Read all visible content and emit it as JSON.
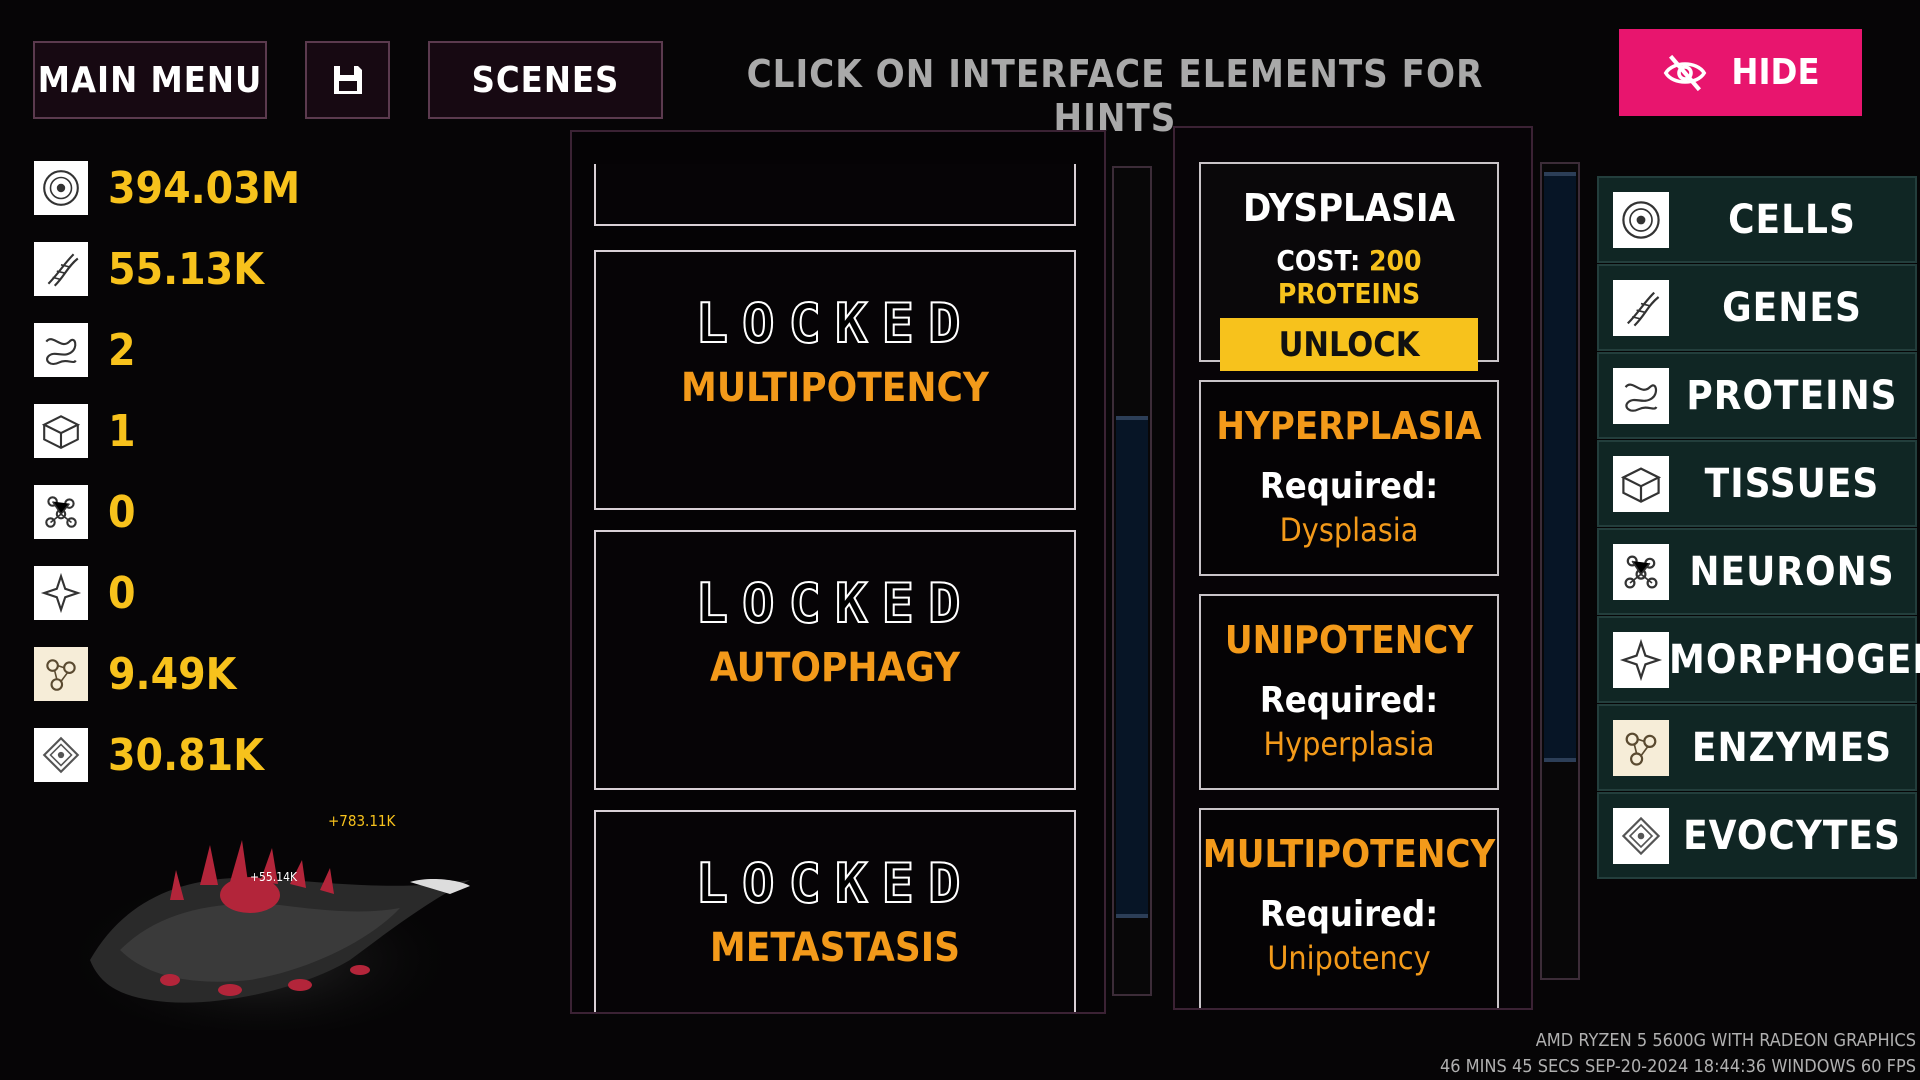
{
  "top_bar": {
    "main_menu": "MAIN MENU",
    "scenes": "SCENES",
    "hint": "CLICK ON INTERFACE ELEMENTS FOR HINTS",
    "hide": "HIDE"
  },
  "resources": [
    {
      "icon": "cell-icon",
      "value": "394.03M"
    },
    {
      "icon": "dna-icon",
      "value": "55.13K"
    },
    {
      "icon": "protein-icon",
      "value": "2"
    },
    {
      "icon": "tissue-icon",
      "value": "1"
    },
    {
      "icon": "neuron-icon",
      "value": "0"
    },
    {
      "icon": "morphogen-icon",
      "value": "0"
    },
    {
      "icon": "enzyme-icon",
      "value": "9.49K"
    },
    {
      "icon": "evocyte-icon",
      "value": "30.81K"
    }
  ],
  "creature": {
    "float_a": "+783.11K",
    "float_b": "+55.14K"
  },
  "locked_panel": {
    "locked_word": "LOCKED",
    "items": [
      "MULTIPOTENCY",
      "AUTOPHAGY",
      "METASTASIS"
    ]
  },
  "upgrades": {
    "first": {
      "title": "DYSPLASIA",
      "cost_label": "COST:",
      "cost_value": "200 PROTEINS",
      "unlock": "UNLOCK"
    },
    "required_label": "Required:",
    "items": [
      {
        "title": "HYPERPLASIA",
        "requires": "Dysplasia"
      },
      {
        "title": "UNIPOTENCY",
        "requires": "Hyperplasia"
      },
      {
        "title": "MULTIPOTENCY",
        "requires": "Unipotency"
      }
    ]
  },
  "categories": [
    {
      "label": "CELLS",
      "icon": "cell-icon"
    },
    {
      "label": "GENES",
      "icon": "dna-icon"
    },
    {
      "label": "PROTEINS",
      "icon": "protein-icon"
    },
    {
      "label": "TISSUES",
      "icon": "tissue-icon"
    },
    {
      "label": "NEURONS",
      "icon": "neuron-icon"
    },
    {
      "label": "MORPHOGENS",
      "icon": "morphogen-icon"
    },
    {
      "label": "ENZYMES",
      "icon": "enzyme-icon"
    },
    {
      "label": "EVOCYTES",
      "icon": "evocyte-icon"
    }
  ],
  "system_info": {
    "line1": "AMD RYZEN 5 5600G WITH RADEON GRAPHICS",
    "line2": "46 MINS 45 SECS   SEP-20-2024 18:44:36   WINDOWS   60 FPS"
  },
  "colors": {
    "accent_yellow": "#f7c21c",
    "accent_orange": "#f39a1a",
    "hide_pink": "#e8156e",
    "tab_teal": "#102624"
  }
}
